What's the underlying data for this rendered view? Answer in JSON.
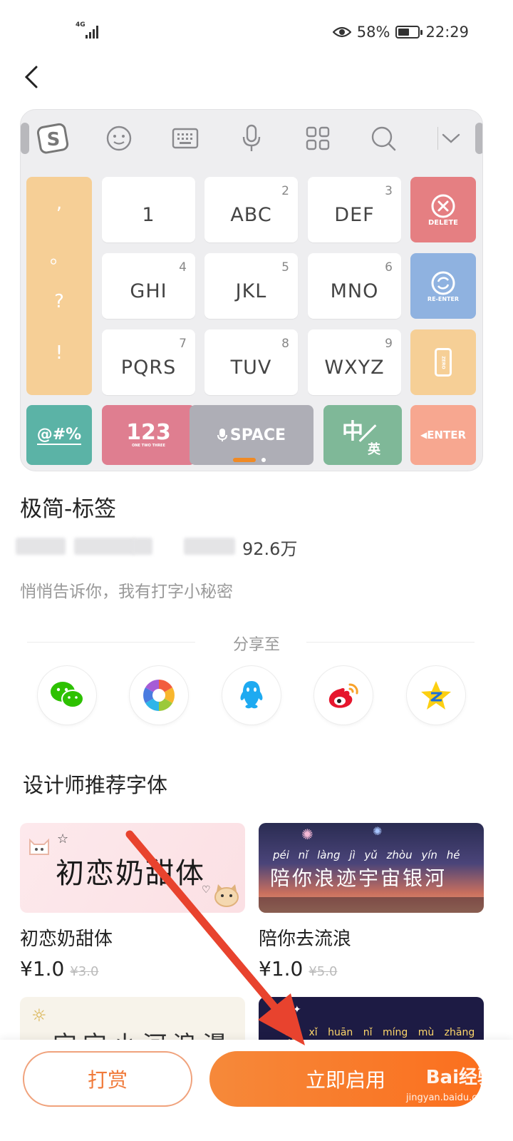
{
  "status_bar": {
    "network": "4G",
    "battery_percent": "58%",
    "battery_level": 0.58,
    "time": "22:29"
  },
  "keyboard_preview": {
    "top_icons": [
      "sogou-logo-icon",
      "emoji-icon",
      "keyboard-icon",
      "microphone-icon",
      "grid-icon",
      "search-icon",
      "chevron-down-icon"
    ],
    "punctuation": [
      ",",
      "。",
      "?",
      "!"
    ],
    "keys": [
      {
        "label": "1",
        "num": ""
      },
      {
        "label": "ABC",
        "num": "2"
      },
      {
        "label": "DEF",
        "num": "3"
      },
      {
        "label": "GHI",
        "num": "4"
      },
      {
        "label": "JKL",
        "num": "5"
      },
      {
        "label": "MNO",
        "num": "6"
      },
      {
        "label": "PQRS",
        "num": "7"
      },
      {
        "label": "TUV",
        "num": "8"
      },
      {
        "label": "WXYZ",
        "num": "9"
      }
    ],
    "side_keys": {
      "delete": "DELETE",
      "reenter": "RE-ENTER",
      "zero": "ZERO"
    },
    "bottom_keys": {
      "symbols": "@#%",
      "numbers": "123",
      "numbers_sub": "ONE TWO THREE",
      "space": "SPACE",
      "lang_cn": "中",
      "lang_en": "英",
      "enter": "ENTER"
    },
    "colors": {
      "orange": "#f6cf96",
      "red": "#e57f82",
      "blue": "#8fb2e0",
      "teal": "#5bb3a6",
      "pink": "#df7e90",
      "gray": "#aeaeb6",
      "green": "#7fb898",
      "salmon": "#f7a790"
    }
  },
  "skin": {
    "title": "极简-标签",
    "downloads": "92.6万",
    "description": "悄悄告诉你，我有打字小秘密"
  },
  "share": {
    "label": "分享至",
    "targets": [
      "wechat-icon",
      "moments-icon",
      "qq-icon",
      "weibo-icon",
      "qzone-icon"
    ]
  },
  "fonts_section": {
    "title": "设计师推荐字体",
    "items": [
      {
        "banner_text": "初恋奶甜体",
        "name": "初恋奶甜体",
        "price": "¥1.0",
        "old_price": "¥3.0"
      },
      {
        "banner_text": "陪你浪迹宇宙银河",
        "pinyin": "péi nǐ làng jì yǔ zhòu yín hé",
        "name": "陪你去流浪",
        "price": "¥1.0",
        "old_price": "¥5.0"
      },
      {
        "banner_text": "宝宝小河浪漫"
      },
      {
        "pinyin": "wǒ xǐ huān nǐ míng mù zhāng dǎn"
      }
    ]
  },
  "actions": {
    "reward": "打赏",
    "enable": "立即启用"
  },
  "watermark": {
    "brand": "Bai经验",
    "url": "jingyan.baidu.com"
  }
}
